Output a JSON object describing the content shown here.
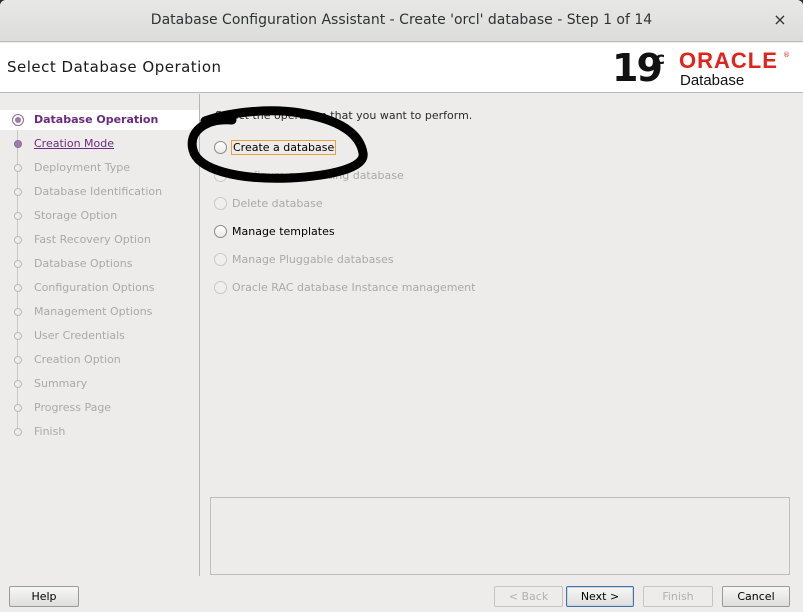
{
  "window": {
    "title": "Database Configuration Assistant - Create 'orcl' database - Step 1 of 14",
    "close_glyph": "×"
  },
  "header": {
    "page_title": "Select Database Operation",
    "logo": {
      "version": "19",
      "version_suffix": "c",
      "brand": "ORACLE",
      "brand_reg": "®",
      "product": "Database",
      "brand_color": "#e0241b"
    }
  },
  "steps": [
    {
      "label": "Database Operation",
      "state": "active"
    },
    {
      "label": "Creation Mode",
      "state": "link"
    },
    {
      "label": "Deployment Type",
      "state": "disabled"
    },
    {
      "label": "Database Identification",
      "state": "disabled"
    },
    {
      "label": "Storage Option",
      "state": "disabled"
    },
    {
      "label": "Fast Recovery Option",
      "state": "disabled"
    },
    {
      "label": "Database Options",
      "state": "disabled"
    },
    {
      "label": "Configuration Options",
      "state": "disabled"
    },
    {
      "label": "Management Options",
      "state": "disabled"
    },
    {
      "label": "User Credentials",
      "state": "disabled"
    },
    {
      "label": "Creation Option",
      "state": "disabled"
    },
    {
      "label": "Summary",
      "state": "disabled"
    },
    {
      "label": "Progress Page",
      "state": "disabled"
    },
    {
      "label": "Finish",
      "state": "disabled"
    }
  ],
  "main": {
    "instruction": "Select the operation that you want to perform.",
    "options": [
      {
        "label": "Create a database",
        "enabled": true,
        "focused": true
      },
      {
        "label": "Configure an existing database",
        "enabled": false
      },
      {
        "label": "Delete database",
        "enabled": false
      },
      {
        "label": "Manage templates",
        "enabled": true
      },
      {
        "label": "Manage Pluggable databases",
        "enabled": false
      },
      {
        "label": "Oracle RAC database Instance management",
        "enabled": false
      }
    ]
  },
  "buttons": {
    "help": "Help",
    "back": "< Back",
    "next": "Next >",
    "finish": "Finish",
    "cancel": "Cancel"
  }
}
